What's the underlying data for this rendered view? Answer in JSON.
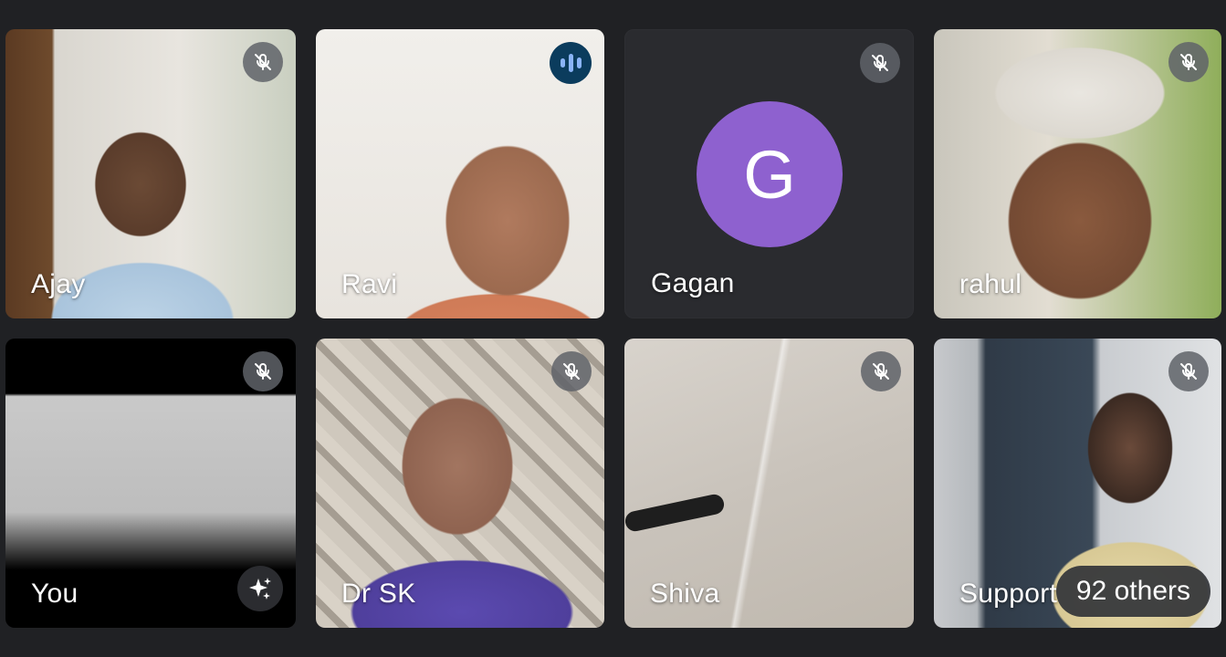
{
  "participants": [
    {
      "name": "Ajay",
      "muted": true
    },
    {
      "name": "Ravi",
      "muted": false,
      "speaking": true
    },
    {
      "name": "Gagan",
      "muted": true,
      "avatar_letter": "G",
      "avatar_color": "#8e61cf"
    },
    {
      "name": "rahul",
      "muted": true
    },
    {
      "name": "You",
      "muted": true,
      "effects_button": "sparkle-icon"
    },
    {
      "name": "Dr SK",
      "muted": true
    },
    {
      "name": "Shiva",
      "muted": true
    },
    {
      "name": "Support",
      "muted": true
    }
  ],
  "others_label": "92 others",
  "colors": {
    "background": "#202124",
    "tile_fallback": "#3c4043",
    "mute_badge": "#5f6368",
    "speaking_badge": "#0b3c5d",
    "speaking_bars": "#8ab4f8",
    "avatar": "#8e61cf"
  }
}
